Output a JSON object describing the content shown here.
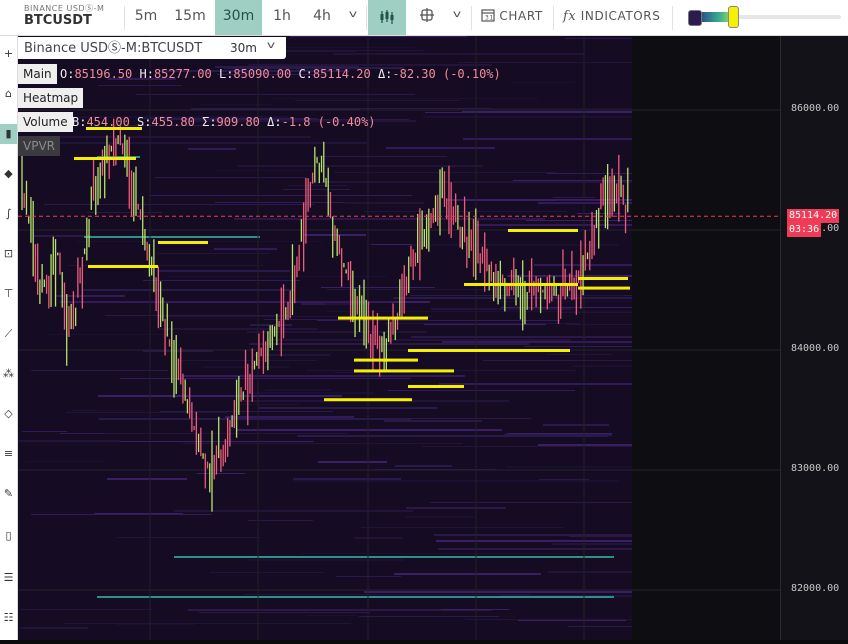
{
  "symbol": {
    "exchange": "BINANCE USDⓈ-M",
    "name": "BTCUSDT"
  },
  "timeframes": [
    "5m",
    "15m",
    "30m",
    "1h",
    "4h"
  ],
  "active_timeframe": "30m",
  "toolbar": {
    "chart_label": "CHART",
    "indicators_label": "INDICATORS",
    "fx_glyph": "fx"
  },
  "chart_header": {
    "title": "Binance USDⓈ-M:BTCUSDT",
    "timeframe": "30m"
  },
  "panels": {
    "main": {
      "label": "Main",
      "o_key": "O:",
      "o": "85196.50",
      "h_key": "H:",
      "h": "85277.00",
      "l_key": "L:",
      "l": "85090.00",
      "c_key": "C:",
      "c": "85114.20",
      "d_key": "Δ:",
      "d": "-82.30 (-0.10%)"
    },
    "heatmap": {
      "label": "Heatmap"
    },
    "volume": {
      "label": "Volume",
      "b_key": "B:",
      "b": "454.00",
      "s_key": "S:",
      "s": "455.80",
      "t_key": "Σ:",
      "t": "909.80",
      "d_key": "Δ:",
      "d": "-1.8 (-0.40%)"
    },
    "vpvr": {
      "label": "VPVR"
    }
  },
  "price_axis": {
    "ticks": [
      "86000.00",
      "85000.00",
      "84000.00",
      "83000.00",
      "82000.00"
    ],
    "last_price": "85114.20",
    "countdown": "03:36",
    "tick_values": [
      86000,
      85000,
      84000,
      83000,
      82000
    ]
  },
  "colors": {
    "accent": "#9fcfc3",
    "up": "#b7e36a",
    "down": "#ef3b55",
    "order_wall": "#f5f000",
    "last_price_line": "#ef3b55"
  },
  "chart_data": {
    "type": "candlestick",
    "title": "",
    "ylabel": "",
    "ylim": [
      81600,
      86500
    ],
    "last_price": 85114.2,
    "series": [
      {
        "name": "",
        "values": [
          85310,
          85050,
          84500,
          84600,
          84800,
          84200,
          84350,
          84800,
          85300,
          85600,
          85700,
          85750,
          85500,
          85200,
          84900,
          84600,
          84200,
          83900,
          83700,
          83400,
          83150,
          83000,
          83100,
          83250,
          83500,
          83700,
          83900,
          84000,
          84100,
          84250,
          84400,
          84800,
          85300,
          85600,
          85400,
          85000,
          84700,
          84500,
          84300,
          84100,
          84000,
          84100,
          84300,
          84600,
          84800,
          84900,
          85100,
          85300,
          85200,
          85000,
          84900,
          84800,
          84700,
          84600,
          84550,
          84500,
          84450,
          84500,
          84500,
          84500,
          84450,
          84550,
          84500,
          84750,
          85000,
          85250,
          85350,
          85300,
          85114
        ]
      }
    ],
    "order_walls": [
      {
        "price": 85850,
        "side": "ask"
      },
      {
        "price": 85600,
        "side": "ask"
      },
      {
        "price": 85000,
        "side": "bid"
      },
      {
        "price": 84900,
        "side": "bid"
      },
      {
        "price": 84700,
        "side": "bid"
      },
      {
        "price": 84550,
        "side": "bid"
      },
      {
        "price": 84270,
        "side": "bid"
      },
      {
        "price": 84000,
        "side": "bid"
      },
      {
        "price": 83920,
        "side": "bid"
      },
      {
        "price": 83830,
        "side": "bid"
      },
      {
        "price": 83700,
        "side": "bid"
      },
      {
        "price": 83590,
        "side": "bid"
      },
      {
        "price": 84520,
        "side": "ask"
      },
      {
        "price": 84600,
        "side": "ask"
      }
    ]
  }
}
